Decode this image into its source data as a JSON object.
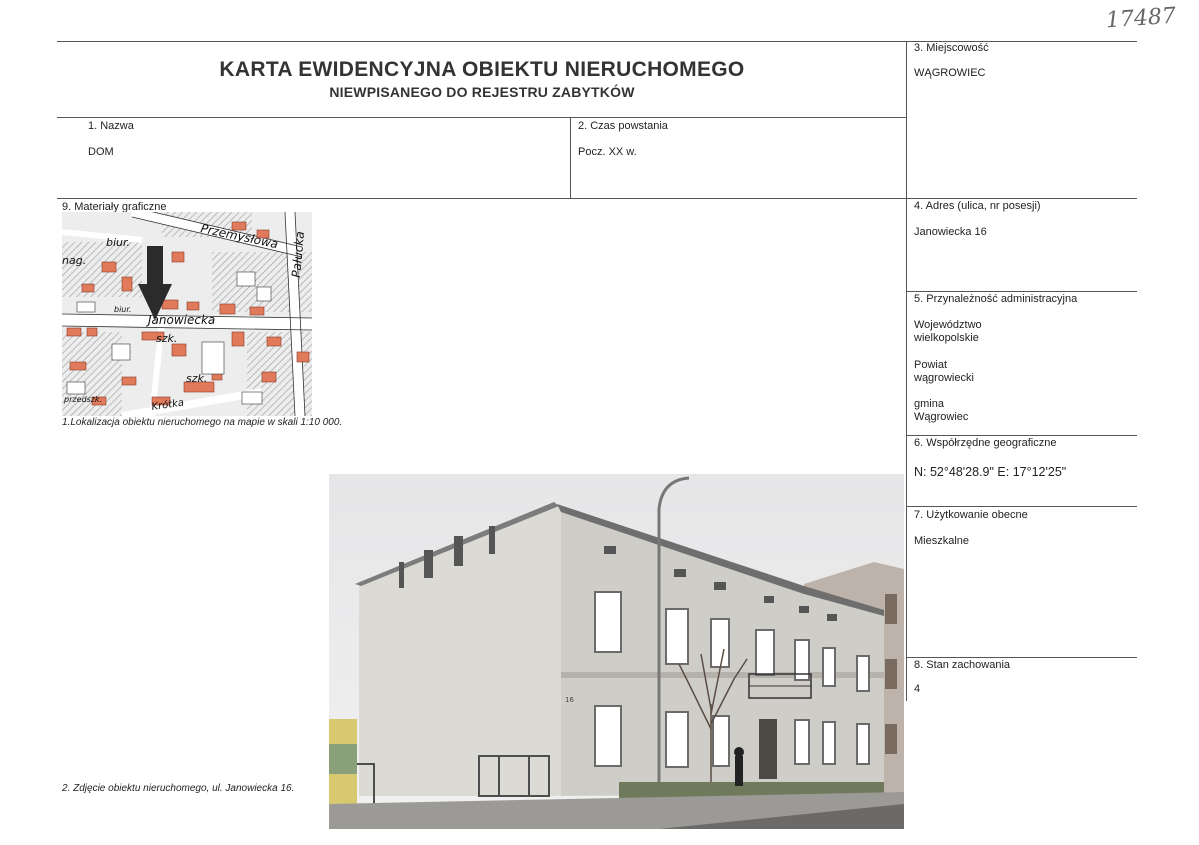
{
  "handwritten_number": "17487",
  "title": {
    "main": "KARTA EWIDENCYJNA OBIEKTU NIERUCHOMEGO",
    "sub": "NIEWPISANEGO DO REJESTRU ZABYTKÓW"
  },
  "fields": {
    "nazwa": {
      "label": "1.     Nazwa",
      "value": "DOM"
    },
    "czas": {
      "label": "2. Czas powstania",
      "value": "Pocz. XX w."
    },
    "miejscowosc": {
      "label": "3. Miejscowość",
      "value": "WĄGROWIEC"
    },
    "adres": {
      "label": "4. Adres (ulica, nr posesji)",
      "value": "Janowiecka 16"
    },
    "przynaleznosc": {
      "label": "5. Przynależność administracyjna",
      "woj_label": "Województwo",
      "woj_value": "wielkopolskie",
      "powiat_label": "Powiat",
      "powiat_value": "wągrowiecki",
      "gmina_label": "gmina",
      "gmina_value": "Wągrowiec"
    },
    "wspolrzedne": {
      "label": "6. Współrzędne geograficzne",
      "value": "N: 52°48'28.9\"  E: 17°12'25\""
    },
    "uzytkowanie": {
      "label": "7. Użytkowanie obecne",
      "value": "Mieszkalne"
    },
    "stan": {
      "label": "8. Stan zachowania",
      "value": "4"
    },
    "materialy": {
      "label": "9. Materiały graficzne"
    }
  },
  "map": {
    "streets": [
      "Przemysłowa",
      "Pałucka",
      "Janowiecka",
      "Krótka"
    ],
    "labels": [
      "biur.",
      "nag.",
      "szk.",
      "szk.",
      "biur.",
      "przedszk."
    ]
  },
  "captions": {
    "map": "1.Lokalizacja obiektu nieruchomego na mapie w skali 1:10 000.",
    "photo": "2. Zdjęcie obiektu nieruchomego, ul. Janowiecka 16."
  },
  "photo": {
    "house_number": "16"
  }
}
